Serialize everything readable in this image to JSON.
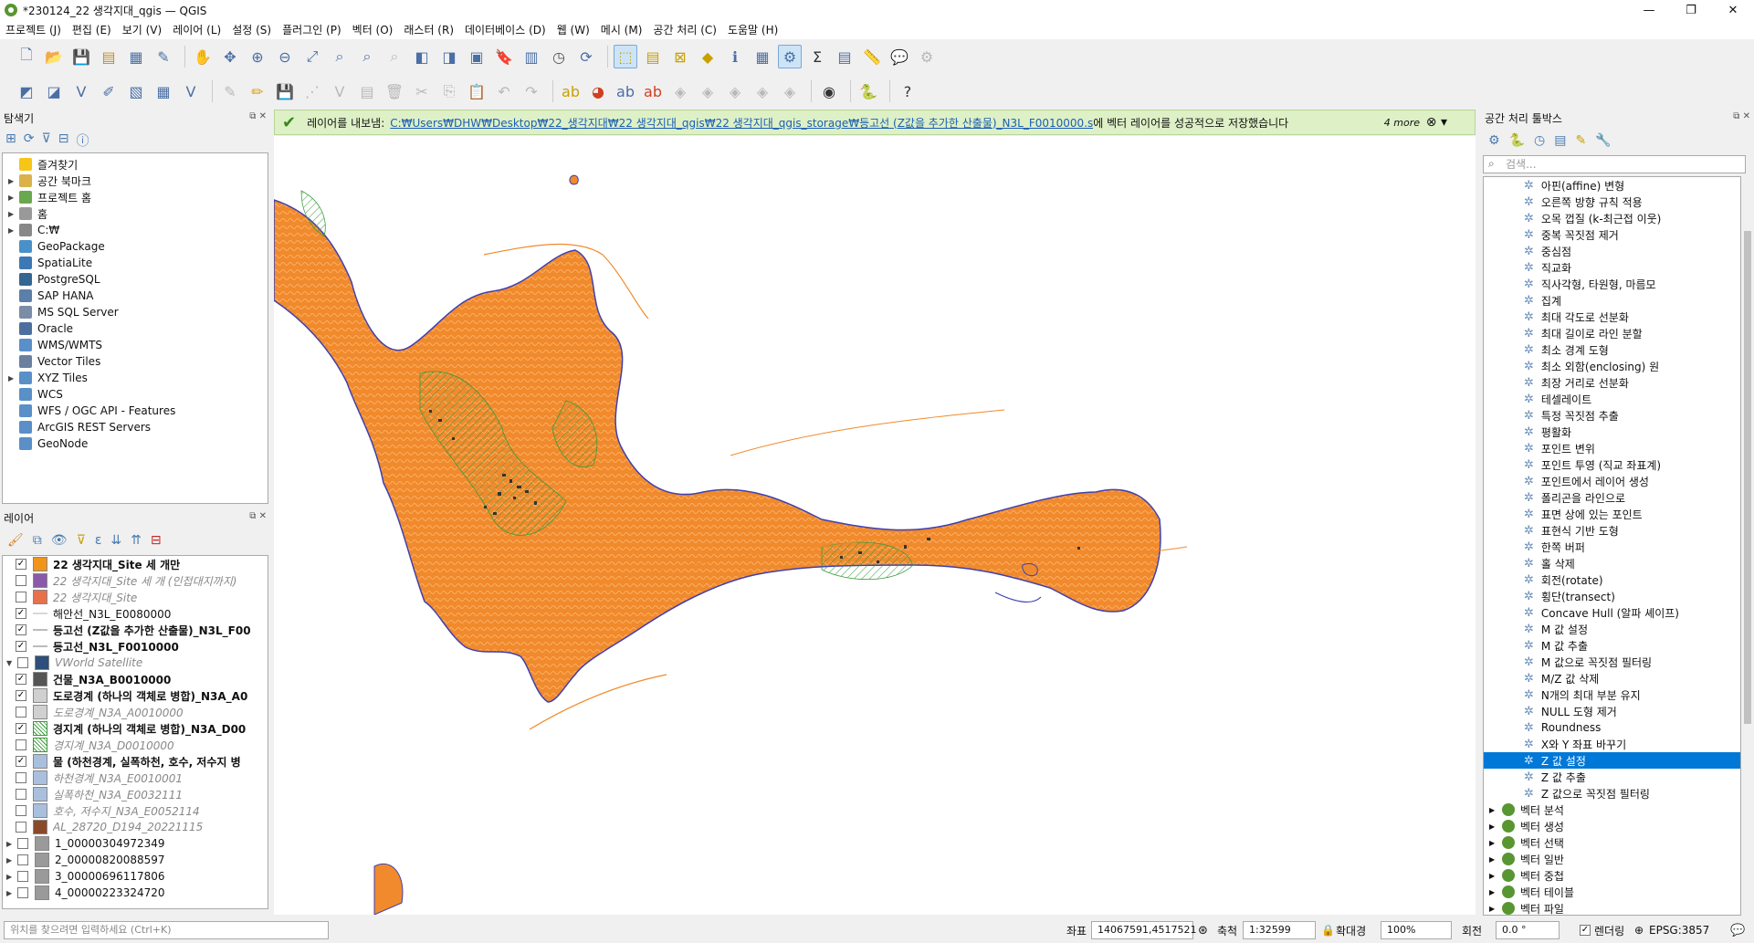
{
  "window": {
    "title": "*230124_22 생각지대_qgis — QGIS",
    "min": "—",
    "max": "❐",
    "close": "✕"
  },
  "menu": [
    "프로젝트 (J)",
    "편집 (E)",
    "보기 (V)",
    "레이어 (L)",
    "설정 (S)",
    "플러그인 (P)",
    "벡터 (O)",
    "래스터 (R)",
    "데이터베이스 (D)",
    "웹 (W)",
    "메시 (M)",
    "공간 처리 (C)",
    "도움말 (H)"
  ],
  "explorer": {
    "title": "탐색기",
    "items": [
      {
        "label": "즐겨찾기",
        "icon": "star-icon",
        "color": "#f5c518",
        "arrow": ""
      },
      {
        "label": "공간 북마크",
        "icon": "bookmark-icon",
        "color": "#d9b24a",
        "arrow": "▶"
      },
      {
        "label": "프로젝트 홈",
        "icon": "project-home-icon",
        "color": "#6aa84f",
        "arrow": "▶"
      },
      {
        "label": "홈",
        "icon": "home-folder-icon",
        "color": "#999999",
        "arrow": "▶"
      },
      {
        "label": "C:₩",
        "icon": "drive-icon",
        "color": "#888888",
        "arrow": "▶"
      },
      {
        "label": "GeoPackage",
        "icon": "geopackage-icon",
        "color": "#4a90c8",
        "arrow": ""
      },
      {
        "label": "SpatiaLite",
        "icon": "spatialite-icon",
        "color": "#3c78b4",
        "arrow": ""
      },
      {
        "label": "PostgreSQL",
        "icon": "postgresql-icon",
        "color": "#336791",
        "arrow": ""
      },
      {
        "label": "SAP HANA",
        "icon": "sap-hana-icon",
        "color": "#5b7fa8",
        "arrow": ""
      },
      {
        "label": "MS SQL Server",
        "icon": "mssql-icon",
        "color": "#7a8ca6",
        "arrow": ""
      },
      {
        "label": "Oracle",
        "icon": "oracle-icon",
        "color": "#4d6fa0",
        "arrow": ""
      },
      {
        "label": "WMS/WMTS",
        "icon": "wms-icon",
        "color": "#5a8fc8",
        "arrow": ""
      },
      {
        "label": "Vector Tiles",
        "icon": "vector-tiles-icon",
        "color": "#6b7fa0",
        "arrow": ""
      },
      {
        "label": "XYZ Tiles",
        "icon": "xyz-tiles-icon",
        "color": "#5a8fc8",
        "arrow": "▶"
      },
      {
        "label": "WCS",
        "icon": "wcs-icon",
        "color": "#5a8fc8",
        "arrow": ""
      },
      {
        "label": "WFS / OGC API - Features",
        "icon": "wfs-icon",
        "color": "#5a8fc8",
        "arrow": ""
      },
      {
        "label": "ArcGIS REST Servers",
        "icon": "arcgis-icon",
        "color": "#5a8fc8",
        "arrow": ""
      },
      {
        "label": "GeoNode",
        "icon": "geonode-icon",
        "color": "#5a8fc8",
        "arrow": ""
      }
    ]
  },
  "layers": {
    "title": "레이어",
    "items": [
      {
        "label": "22 생각지대_Site 세 개만",
        "checked": "✓",
        "color": "#f0941c",
        "style": "bd",
        "indent": 24
      },
      {
        "label": "22 생각지대_Site 세 개 (인접대지까지)",
        "checked": "",
        "color": "#8a5aa8",
        "style": "it",
        "indent": 24
      },
      {
        "label": "22 생각지대_Site",
        "checked": "",
        "color": "#e8704a",
        "style": "it",
        "indent": 24
      },
      {
        "label": "해안선_N3L_E0080000",
        "checked": "✓",
        "color": "#d8d8d8",
        "style": "",
        "indent": 24,
        "line": true
      },
      {
        "label": "등고선 (Z값을 추가한 산출물)_N3L_F00",
        "checked": "✓",
        "color": "#bbbbbb",
        "style": "bd",
        "indent": 24,
        "line": true
      },
      {
        "label": "등고선_N3L_F0010000",
        "checked": "✓",
        "color": "#bbbbbb",
        "style": "bd",
        "indent": 24,
        "line": true
      },
      {
        "label": "VWorld Satellite",
        "checked": "",
        "color": "#2d4f7a",
        "style": "it",
        "indent": 4,
        "arrow": "▼"
      },
      {
        "label": "건물_N3A_B0010000",
        "checked": "✓",
        "color": "#555555",
        "style": "bd",
        "indent": 24
      },
      {
        "label": "도로경계 (하나의 객체로 병합)_N3A_A0",
        "checked": "✓",
        "color": "#d0d0d0",
        "style": "bd",
        "indent": 24
      },
      {
        "label": "도로경계_N3A_A0010000",
        "checked": "",
        "color": "#d0d0d0",
        "style": "it",
        "indent": 24
      },
      {
        "label": "경지계 (하나의 객체로 병합)_N3A_D00",
        "checked": "✓",
        "color": "#ffffff",
        "style": "bd",
        "indent": 24,
        "hatch": true
      },
      {
        "label": "경지계_N3A_D0010000",
        "checked": "",
        "color": "#ffffff",
        "style": "it",
        "indent": 24,
        "hatch": true
      },
      {
        "label": "물 (하천경계, 실폭하천, 호수, 저수지 병",
        "checked": "✓",
        "color": "#a8c0de",
        "style": "bd",
        "indent": 24
      },
      {
        "label": "하천경계_N3A_E0010001",
        "checked": "",
        "color": "#a8c0de",
        "style": "it",
        "indent": 24
      },
      {
        "label": "실폭하천_N3A_E0032111",
        "checked": "",
        "color": "#a8c0de",
        "style": "it",
        "indent": 24
      },
      {
        "label": "호수, 저수지_N3A_E0052114",
        "checked": "",
        "color": "#a8c0de",
        "style": "it",
        "indent": 24
      },
      {
        "label": "AL_28720_D194_20221115",
        "checked": "",
        "color": "#8a4a2a",
        "style": "it",
        "indent": 24
      },
      {
        "label": "1_00000304972349",
        "checked": "",
        "color": "#9a9a9a",
        "style": "",
        "indent": 4,
        "arrow": "▶"
      },
      {
        "label": "2_00000820088597",
        "checked": "",
        "color": "#9a9a9a",
        "style": "",
        "indent": 4,
        "arrow": "▶"
      },
      {
        "label": "3_00000696117806",
        "checked": "",
        "color": "#9a9a9a",
        "style": "",
        "indent": 4,
        "arrow": "▶"
      },
      {
        "label": "4_00000223324720",
        "checked": "",
        "color": "#9a9a9a",
        "style": "",
        "indent": 4,
        "arrow": "▶"
      }
    ]
  },
  "message": {
    "prefix": "레이어를 내보냄:",
    "link": "C:₩Users₩DHW₩Desktop₩22_생각지대₩22 생각지대_qgis₩22 생각지대_qgis_storage₩등고선 (Z값을 추가한 산출물)_N3L_F0010000.shp",
    "suffix": "에 벡터 레이어를 성공적으로 저장했습니다",
    "more": "4 more"
  },
  "toolbox": {
    "title": "공간 처리 툴박스",
    "search_placeholder": "검색...",
    "algorithms": [
      "아핀(affine) 변형",
      "오른쪽 방향 규칙 적용",
      "오목 껍질 (k-최근접 이웃)",
      "중복 꼭짓점 제거",
      "중심점",
      "직교화",
      "직사각형, 타원형, 마름모",
      "집계",
      "최대 각도로 선분화",
      "최대 길이로 라인 분할",
      "최소 경계 도형",
      "최소 외함(enclosing) 원",
      "최장 거리로 선분화",
      "테셀레이트",
      "특정 꼭짓점 추출",
      "평활화",
      "포인트 변위",
      "포인트 투영 (직교 좌표계)",
      "포인트에서 레이어 생성",
      "폴리곤을 라인으로",
      "표면 상에 있는 포인트",
      "표현식 기반 도형",
      "한쪽 버퍼",
      "홀 삭제",
      "회전(rotate)",
      "횡단(transect)",
      "Concave Hull (알파 셰이프)",
      "M 값 설정",
      "M 값 추출",
      "M 값으로 꼭짓점 필터링",
      "M/Z 값 삭제",
      "N개의 최대 부분 유지",
      "NULL 도형 제거",
      "Roundness",
      "X와 Y 좌표 바꾸기",
      "Z 값 설정",
      "Z 값 추출",
      "Z 값으로 꼭짓점 필터링"
    ],
    "selected_index": 35,
    "groups": [
      "벡터 분석",
      "벡터 생성",
      "벡터 선택",
      "벡터 일반",
      "벡터 중첩",
      "벡터 테이블",
      "벡터 파일"
    ]
  },
  "status": {
    "locator_placeholder": "위치를 찾으려면 입력하세요 (Ctrl+K)",
    "coord_label": "좌표",
    "coord_value": "14067591,4517521",
    "scale_label": "축척",
    "scale_value": "1:32599",
    "magnifier_label": "확대경",
    "magnifier_value": "100%",
    "rotation_label": "회전",
    "rotation_value": "0.0 °",
    "render_label": "렌더링",
    "crs": "EPSG:3857"
  }
}
